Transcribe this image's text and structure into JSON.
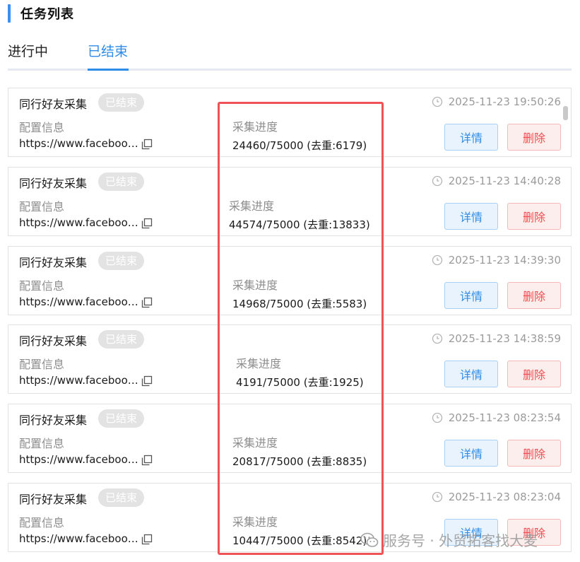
{
  "header": {
    "title": "任务列表"
  },
  "tabs": [
    {
      "label": "进行中",
      "active": false
    },
    {
      "label": "已结束",
      "active": true
    }
  ],
  "colors": {
    "accent": "#2f8ce6",
    "danger": "#ee4e4e",
    "highlight": "#ef5358",
    "badge_bg": "#e3e3e3"
  },
  "tasks": [
    {
      "name": "同行好友采集",
      "status": "已结束",
      "config_label": "配置信息",
      "config_url": "https://www.faceboo…",
      "progress_label": "采集进度",
      "progress": "24460/75000 (去重:6179)",
      "time": "2025-11-23 19:50:26",
      "detail_label": "详情",
      "delete_label": "删除"
    },
    {
      "name": "同行好友采集",
      "status": "已结束",
      "config_label": "配置信息",
      "config_url": "https://www.faceboo…",
      "progress_label": "采集进度",
      "progress": "44574/75000 (去重:13833)",
      "time": "2025-11-23 14:40:28",
      "detail_label": "详情",
      "delete_label": "删除"
    },
    {
      "name": "同行好友采集",
      "status": "已结束",
      "config_label": "配置信息",
      "config_url": "https://www.faceboo…",
      "progress_label": "采集进度",
      "progress": "14968/75000 (去重:5583)",
      "time": "2025-11-23 14:39:30",
      "detail_label": "详情",
      "delete_label": "删除"
    },
    {
      "name": "同行好友采集",
      "status": "已结束",
      "config_label": "配置信息",
      "config_url": "https://www.faceboo…",
      "progress_label": "采集进度",
      "progress": "4191/75000 (去重:1925)",
      "time": "2025-11-23 14:38:59",
      "detail_label": "详情",
      "delete_label": "删除"
    },
    {
      "name": "同行好友采集",
      "status": "已结束",
      "config_label": "配置信息",
      "config_url": "https://www.faceboo…",
      "progress_label": "采集进度",
      "progress": "20817/75000 (去重:8835)",
      "time": "2025-11-23 08:23:54",
      "detail_label": "详情",
      "delete_label": "删除"
    },
    {
      "name": "同行好友采集",
      "status": "已结束",
      "config_label": "配置信息",
      "config_url": "https://www.faceboo…",
      "progress_label": "采集进度",
      "progress": "10447/75000 (去重:8542)",
      "time": "2025-11-23 08:23:04",
      "detail_label": "详情",
      "delete_label": "删除"
    }
  ],
  "watermark": {
    "icon": "wechat-icon",
    "text": "服务号 · 外贸拓客找大麦"
  }
}
